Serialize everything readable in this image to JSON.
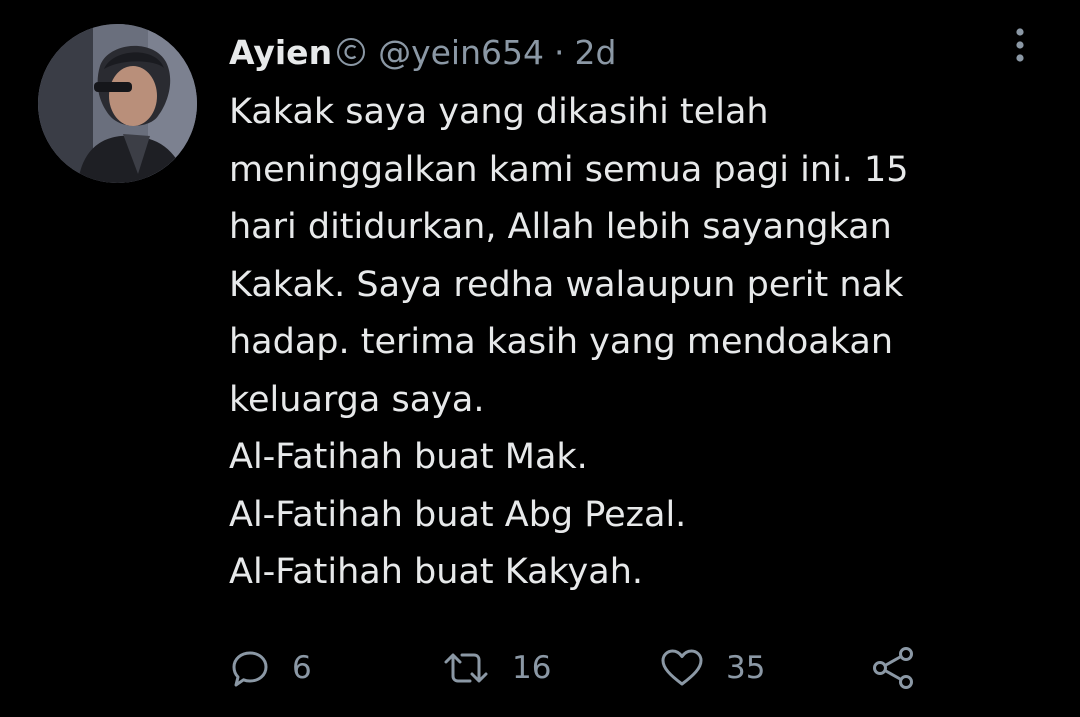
{
  "tweet": {
    "author_name": "Ayien",
    "handle": "@yein654",
    "separator": "·",
    "time": "2d",
    "lines": [
      "Kakak saya yang dikasihi telah",
      "meninggalkan kami semua pagi ini. 15",
      "hari ditidurkan, Allah lebih sayangkan",
      "Kakak. Saya redha walaupun perit nak",
      "hadap. terima kasih yang mendoakan",
      "keluarga saya.",
      "Al-Fatihah buat Mak.",
      "Al-Fatihah buat Abg Pezal.",
      "Al-Fatihah buat Kakyah."
    ],
    "actions": {
      "reply_count": "6",
      "retweet_count": "16",
      "like_count": "35"
    }
  },
  "icons": {
    "badge": "copyright-circle-icon",
    "more": "vertical-dots-icon",
    "reply": "speech-bubble-icon",
    "retweet": "retweet-arrows-icon",
    "like": "heart-outline-icon",
    "share": "share-nodes-icon"
  },
  "colors": {
    "background": "#000000",
    "primary_text": "#e7e9ea",
    "secondary_text": "#8b98a5"
  }
}
